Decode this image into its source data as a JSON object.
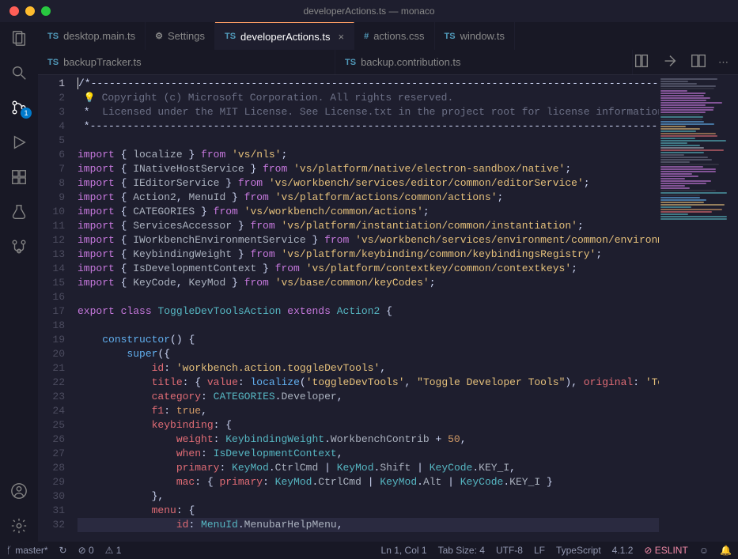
{
  "title": "developerActions.ts — monaco",
  "tabs_top": [
    {
      "icon": "TS",
      "icon_class": "ts-icon",
      "label": "desktop.main.ts"
    },
    {
      "icon": "⚙",
      "icon_class": "gear-icon",
      "label": "Settings"
    },
    {
      "icon": "TS",
      "icon_class": "ts-icon",
      "label": "developerActions.ts",
      "active": true,
      "closeable": true
    },
    {
      "icon": "#",
      "icon_class": "css-icon",
      "label": "actions.css"
    },
    {
      "icon": "TS",
      "icon_class": "ts-icon",
      "label": "window.ts"
    }
  ],
  "tabs_second": [
    {
      "icon": "TS",
      "icon_class": "ts-icon",
      "label": "backupTracker.ts"
    },
    {
      "icon": "TS",
      "icon_class": "ts-icon",
      "label": "backup.contribution.ts"
    }
  ],
  "scm_badge": "1",
  "code_lines": [
    {
      "n": 1,
      "html": "<span class='cursor'></span>/*---------------------------------------------------------------------------------------------"
    },
    {
      "n": 2,
      "html": " <span class='bulb'>💡</span> <span class='tok-cmt'>Copyright (c) Microsoft Corporation. All rights reserved.</span>"
    },
    {
      "n": 3,
      "html": " *  <span class='tok-cmt'>Licensed under the MIT License. See License.txt in the project root for license information.</span>"
    },
    {
      "n": 4,
      "html": " *--------------------------------------------------------------------------------------------*/"
    },
    {
      "n": 5,
      "html": ""
    },
    {
      "n": 6,
      "html": "<span class='tok-kw'>import</span> { <span class='tok-id'>localize</span> } <span class='tok-kw'>from</span> <span class='tok-str'>'vs/nls'</span>;"
    },
    {
      "n": 7,
      "html": "<span class='tok-kw'>import</span> { <span class='tok-id'>INativeHostService</span> } <span class='tok-kw'>from</span> <span class='tok-str'>'vs/platform/native/electron-sandbox/native'</span>;"
    },
    {
      "n": 8,
      "html": "<span class='tok-kw'>import</span> { <span class='tok-id'>IEditorService</span> } <span class='tok-kw'>from</span> <span class='tok-str'>'vs/workbench/services/editor/common/editorService'</span>;"
    },
    {
      "n": 9,
      "html": "<span class='tok-kw'>import</span> { <span class='tok-id'>Action2</span>, <span class='tok-id'>MenuId</span> } <span class='tok-kw'>from</span> <span class='tok-str'>'vs/platform/actions/common/actions'</span>;"
    },
    {
      "n": 10,
      "html": "<span class='tok-kw'>import</span> { <span class='tok-id'>CATEGORIES</span> } <span class='tok-kw'>from</span> <span class='tok-str'>'vs/workbench/common/actions'</span>;"
    },
    {
      "n": 11,
      "html": "<span class='tok-kw'>import</span> { <span class='tok-id'>ServicesAccessor</span> } <span class='tok-kw'>from</span> <span class='tok-str'>'vs/platform/instantiation/common/instantiation'</span>;"
    },
    {
      "n": 12,
      "html": "<span class='tok-kw'>import</span> { <span class='tok-id'>IWorkbenchEnvironmentService</span> } <span class='tok-kw'>from</span> <span class='tok-str'>'vs/workbench/services/environment/common/environme</span>"
    },
    {
      "n": 13,
      "html": "<span class='tok-kw'>import</span> { <span class='tok-id'>KeybindingWeight</span> } <span class='tok-kw'>from</span> <span class='tok-str'>'vs/platform/keybinding/common/keybindingsRegistry'</span>;"
    },
    {
      "n": 14,
      "html": "<span class='tok-kw'>import</span> { <span class='tok-id'>IsDevelopmentContext</span> } <span class='tok-kw'>from</span> <span class='tok-str'>'vs/platform/contextkey/common/contextkeys'</span>;"
    },
    {
      "n": 15,
      "html": "<span class='tok-kw'>import</span> { <span class='tok-id'>KeyCode</span>, <span class='tok-id'>KeyMod</span> } <span class='tok-kw'>from</span> <span class='tok-str'>'vs/base/common/keyCodes'</span>;"
    },
    {
      "n": 16,
      "html": ""
    },
    {
      "n": 17,
      "html": "<span class='tok-kw'>export</span> <span class='tok-kw'>class</span> <span class='tok-type'>ToggleDevToolsAction</span> <span class='tok-kw'>extends</span> <span class='tok-type'>Action2</span> {"
    },
    {
      "n": 18,
      "html": ""
    },
    {
      "n": 19,
      "html": "    <span class='tok-fn'>constructor</span>() {"
    },
    {
      "n": 20,
      "html": "        <span class='tok-fn'>super</span>({"
    },
    {
      "n": 21,
      "html": "            <span class='tok-prop'>id</span>: <span class='tok-str'>'workbench.action.toggleDevTools'</span>,"
    },
    {
      "n": 22,
      "html": "            <span class='tok-prop'>title</span>: { <span class='tok-prop'>value</span>: <span class='tok-fn'>localize</span>(<span class='tok-str'>'toggleDevTools'</span>, <span class='tok-str'>\"Toggle Developer Tools\"</span>), <span class='tok-prop'>original</span>: <span class='tok-str'>'Tog</span>"
    },
    {
      "n": 23,
      "html": "            <span class='tok-prop'>category</span>: <span class='tok-type'>CATEGORIES</span>.<span class='tok-id'>Developer</span>,"
    },
    {
      "n": 24,
      "html": "            <span class='tok-prop'>f1</span>: <span class='tok-bool'>true</span>,"
    },
    {
      "n": 25,
      "html": "            <span class='tok-prop'>keybinding</span>: {"
    },
    {
      "n": 26,
      "html": "                <span class='tok-prop'>weight</span>: <span class='tok-type'>KeybindingWeight</span>.<span class='tok-id'>WorkbenchContrib</span> + <span class='tok-num'>50</span>,"
    },
    {
      "n": 27,
      "html": "                <span class='tok-prop'>when</span>: <span class='tok-type'>IsDevelopmentContext</span>,"
    },
    {
      "n": 28,
      "html": "                <span class='tok-prop'>primary</span>: <span class='tok-type'>KeyMod</span>.<span class='tok-id'>CtrlCmd</span> | <span class='tok-type'>KeyMod</span>.<span class='tok-id'>Shift</span> | <span class='tok-type'>KeyCode</span>.<span class='tok-id'>KEY_I</span>,"
    },
    {
      "n": 29,
      "html": "                <span class='tok-prop'>mac</span>: { <span class='tok-prop'>primary</span>: <span class='tok-type'>KeyMod</span>.<span class='tok-id'>CtrlCmd</span> | <span class='tok-type'>KeyMod</span>.<span class='tok-id'>Alt</span> | <span class='tok-type'>KeyCode</span>.<span class='tok-id'>KEY_I</span> }"
    },
    {
      "n": 30,
      "html": "            },"
    },
    {
      "n": 31,
      "html": "            <span class='tok-prop'>menu</span>: {"
    },
    {
      "n": 32,
      "html": "                <span class='tok-prop'>id</span>: <span class='tok-type'>MenuId</span>.<span class='tok-id'>MenubarHelpMenu</span>,",
      "hl": true
    }
  ],
  "status": {
    "branch": "master*",
    "sync": "↻",
    "errors": "⊘ 0",
    "warnings": "⚠ 1",
    "position": "Ln 1, Col 1",
    "tabsize": "Tab Size: 4",
    "encoding": "UTF-8",
    "eol": "LF",
    "language": "TypeScript",
    "version": "4.1.2",
    "eslint": "⊘ ESLINT",
    "feedback": "☺",
    "bell": "🔔"
  }
}
